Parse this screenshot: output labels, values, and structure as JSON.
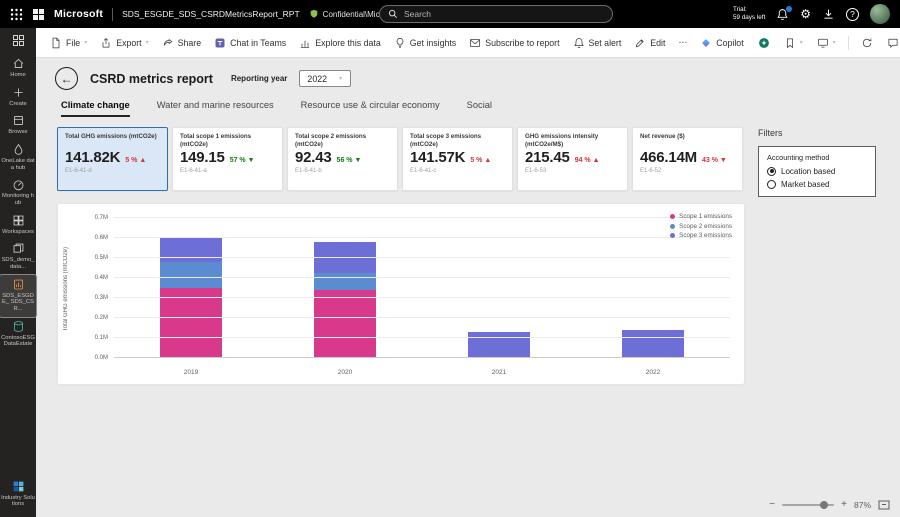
{
  "topbar": {
    "brand": "Microsoft",
    "report_id": "SDS_ESGDE_SDS_CSRDMetricsReport_RPT",
    "sensitivity_label": "Confidential\\Microsoft Extended",
    "search_placeholder": "Search",
    "trial_line1": "Trial:",
    "trial_line2": "59 days left"
  },
  "icons": {
    "gear": "⚙",
    "star": "☆",
    "chevron": "▾",
    "back": "←",
    "more": "⋯",
    "help": "?",
    "minus": "−",
    "plus": "+"
  },
  "rail": {
    "items": [
      {
        "label": "Home",
        "icon": "home",
        "selected": false
      },
      {
        "label": "Create",
        "icon": "create",
        "selected": false
      },
      {
        "label": "Browse",
        "icon": "browse",
        "selected": false
      },
      {
        "label": "OneLake data hub",
        "icon": "onelake",
        "selected": false
      },
      {
        "label": "Monitoring hub",
        "icon": "monitoring",
        "selected": false
      },
      {
        "label": "Workspaces",
        "icon": "workspaces",
        "selected": false
      },
      {
        "label": "SDS_demo_ data...",
        "icon": "workspace",
        "selected": false
      },
      {
        "label": "SDS_ESGDE_ SDS_CSR...",
        "icon": "report",
        "selected": true
      },
      {
        "label": "ContosoESG DataEstate",
        "icon": "database",
        "selected": false
      }
    ],
    "bottom": {
      "label": "Industry Solutions",
      "icon": "industry"
    }
  },
  "toolbar": {
    "file": "File",
    "export": "Export",
    "share": "Share",
    "teams": "Chat in Teams",
    "explore": "Explore this data",
    "insights": "Get insights",
    "subscribe": "Subscribe to report",
    "alert": "Set alert",
    "edit": "Edit",
    "copilot": "Copilot"
  },
  "report": {
    "title": "CSRD metrics report",
    "reporting_year_label": "Reporting year",
    "reporting_year_value": "2022",
    "tabs": [
      {
        "label": "Climate change",
        "active": true
      },
      {
        "label": "Water and marine resources",
        "active": false
      },
      {
        "label": "Resource use & circular economy",
        "active": false
      },
      {
        "label": "Social",
        "active": false
      }
    ],
    "cards": [
      {
        "title": "Total GHG emissions (mtCO2e)",
        "value": "141.82K",
        "delta": "5 %",
        "arrow": "▲",
        "delta_color": "#d13438",
        "code": "E1-6-41-d",
        "selected": true
      },
      {
        "title": "Total scope 1 emissions (mtCO2e)",
        "value": "149.15",
        "delta": "57 %",
        "arrow": "▼",
        "delta_color": "#107c10",
        "code": "E1-6-41-a",
        "selected": false
      },
      {
        "title": "Total scope 2 emissions (mtCO2e)",
        "value": "92.43",
        "delta": "56 %",
        "arrow": "▼",
        "delta_color": "#107c10",
        "code": "E1-6-41-b",
        "selected": false
      },
      {
        "title": "Total scope 3 emissions (mtCO2e)",
        "value": "141.57K",
        "delta": "5 %",
        "arrow": "▲",
        "delta_color": "#d13438",
        "code": "E1-6-41-c",
        "selected": false
      },
      {
        "title": "GHG emissions intensity (mtCO2e/M$)",
        "value": "215.45",
        "delta": "94 %",
        "arrow": "▲",
        "delta_color": "#d13438",
        "code": "E1-6-53",
        "selected": false
      },
      {
        "title": "Net revenue ($)",
        "value": "466.14M",
        "delta": "43 %",
        "arrow": "▼",
        "delta_color": "#d13438",
        "code": "E1-6-52",
        "selected": false
      }
    ],
    "filters": {
      "title": "Filters",
      "group_label": "Accounting method",
      "options": [
        {
          "label": "Location based",
          "selected": true
        },
        {
          "label": "Market based",
          "selected": false
        }
      ]
    }
  },
  "chart_data": {
    "type": "bar",
    "stacked": true,
    "categories": [
      "2019",
      "2020",
      "2021",
      "2022"
    ],
    "series": [
      {
        "name": "Scope 1 emissions",
        "color": "#d9398b",
        "values": [
          352000,
          341000,
          150,
          149
        ]
      },
      {
        "name": "Scope 2 emissions",
        "color": "#5b8bd0",
        "values": [
          128000,
          82000,
          95,
          92
        ]
      },
      {
        "name": "Scope 3 emissions",
        "color": "#6d6ed6",
        "values": [
          118000,
          157000,
          132000,
          141570
        ]
      }
    ],
    "title": "",
    "xlabel": "",
    "ylabel": "Total GHG emissions (mtCO2e)",
    "ylim": [
      0,
      700000
    ],
    "y_ticks": [
      "0.0M",
      "0.1M",
      "0.2M",
      "0.3M",
      "0.4M",
      "0.5M",
      "0.6M",
      "0.7M"
    ],
    "grid": true,
    "legend_position": "top-right"
  },
  "status": {
    "zoom": "87%"
  }
}
